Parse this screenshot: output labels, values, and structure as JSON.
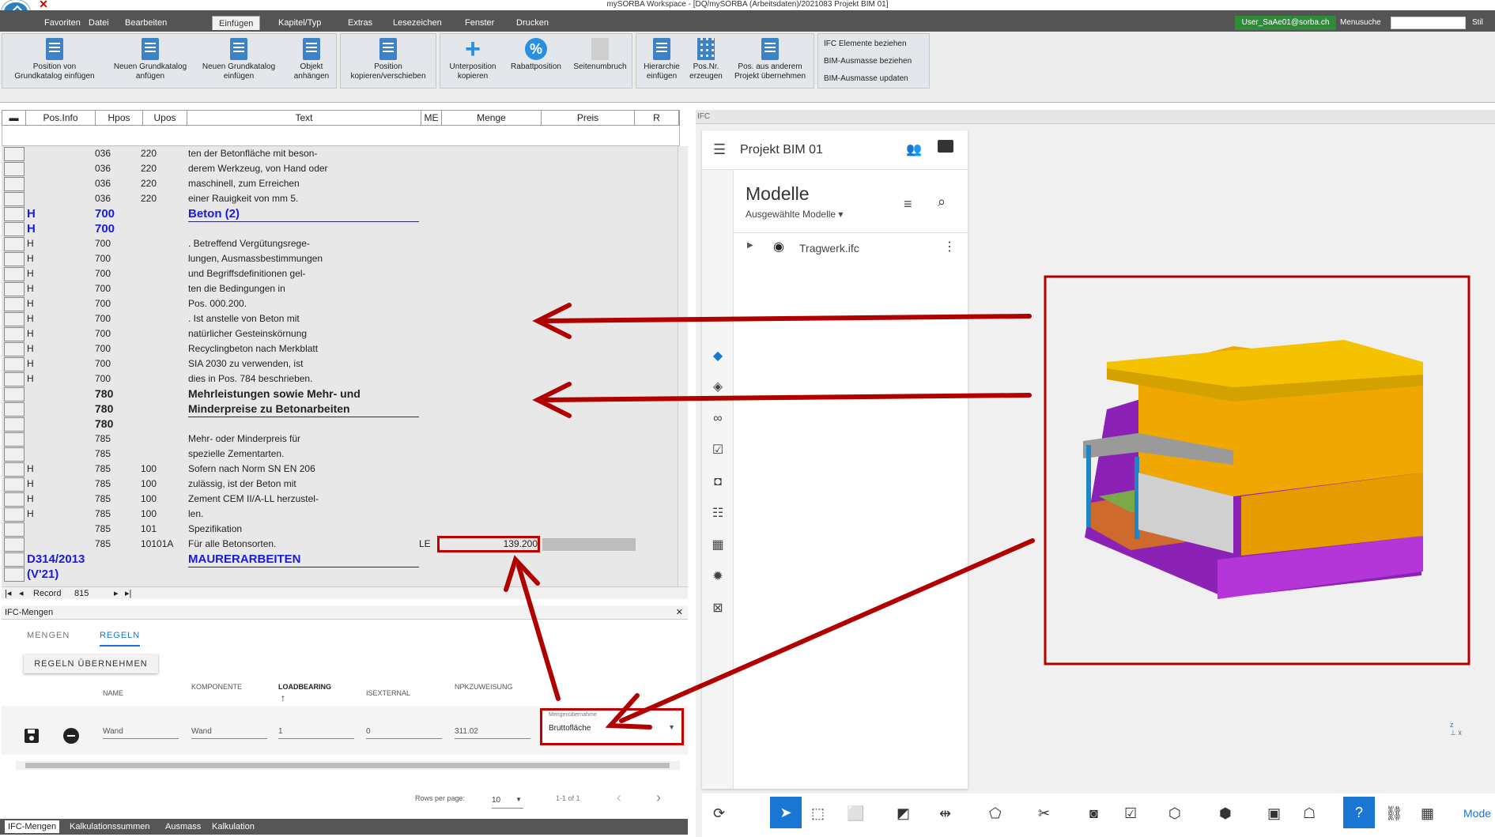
{
  "window": {
    "title": "mySORBA Workspace - [DQ/mySORBA (Arbeitsdaten)/2021083 Projekt BIM 01]"
  },
  "menu": {
    "tabs": [
      "Favoriten",
      "Datei",
      "Bearbeiten",
      "Einfügen",
      "Kapitel/Typ",
      "Extras",
      "Lesezeichen",
      "Fenster",
      "Drucken"
    ],
    "active": "Einfügen",
    "user": "User_SaAe01@sorba.ch",
    "search_label": "Menusuche",
    "style_label": "Stil"
  },
  "ribbon": {
    "buttons": [
      {
        "l1": "Position von",
        "l2": "Grundkatalog einfügen",
        "icon": "doc-icon"
      },
      {
        "l1": "Neuen Grundkatalog",
        "l2": "anfügen",
        "icon": "doc-icon"
      },
      {
        "l1": "Neuen Grundkatalog",
        "l2": "einfügen",
        "icon": "doc-icon"
      },
      {
        "l1": "Objekt",
        "l2": "anhängen",
        "icon": "doc-icon"
      },
      {
        "l1": "Position",
        "l2": "kopieren/verschieben",
        "icon": "doc-icon"
      },
      {
        "l1": "Unterposition",
        "l2": "kopieren",
        "icon": "plus-icon"
      },
      {
        "l1": "Rabattposition",
        "l2": "",
        "icon": "percent-icon"
      },
      {
        "l1": "Seitenumbruch",
        "l2": "",
        "icon": "page-break-icon"
      },
      {
        "l1": "Hierarchie",
        "l2": "einfügen",
        "icon": "hierarchy-icon"
      },
      {
        "l1": "Pos.Nr.",
        "l2": "erzeugen",
        "icon": "grid-icon"
      },
      {
        "l1": "Pos. aus anderem",
        "l2": "Projekt übernehmen",
        "icon": "doc-icon"
      }
    ],
    "ifc_buttons": [
      "IFC Elemente beziehen",
      "BIM-Ausmasse beziehen",
      "BIM-Ausmasse updaten"
    ]
  },
  "grid": {
    "columns": [
      "Pos.Info",
      "Hpos",
      "Upos",
      "Text",
      "ME",
      "Menge",
      "Preis",
      "R"
    ],
    "rows": [
      {
        "info": "",
        "hpos": "036",
        "upos": "220",
        "text": "ten der Betonfläche mit beson-",
        "me": "",
        "menge": "",
        "style": ""
      },
      {
        "info": "",
        "hpos": "036",
        "upos": "220",
        "text": "derem Werkzeug, von Hand oder",
        "me": "",
        "menge": "",
        "style": ""
      },
      {
        "info": "",
        "hpos": "036",
        "upos": "220",
        "text": "maschinell, zum Erreichen",
        "me": "",
        "menge": "",
        "style": ""
      },
      {
        "info": "",
        "hpos": "036",
        "upos": "220",
        "text": "einer Rauigkeit von mm 5.",
        "me": "",
        "menge": "",
        "style": ""
      },
      {
        "info": "H",
        "hpos": "700",
        "upos": "",
        "text": "Beton (2)",
        "me": "",
        "menge": "",
        "style": "blue"
      },
      {
        "info": "H",
        "hpos": "700",
        "upos": "",
        "text": "",
        "me": "",
        "menge": "",
        "style": "blue"
      },
      {
        "info": "H",
        "hpos": "700",
        "upos": "",
        "text": ". Betreffend Vergütungsrege-",
        "me": "",
        "menge": "",
        "style": ""
      },
      {
        "info": "H",
        "hpos": "700",
        "upos": "",
        "text": "lungen, Ausmassbestimmungen",
        "me": "",
        "menge": "",
        "style": ""
      },
      {
        "info": "H",
        "hpos": "700",
        "upos": "",
        "text": "und Begriffsdefinitionen gel-",
        "me": "",
        "menge": "",
        "style": ""
      },
      {
        "info": "H",
        "hpos": "700",
        "upos": "",
        "text": "ten die Bedingungen in",
        "me": "",
        "menge": "",
        "style": ""
      },
      {
        "info": "H",
        "hpos": "700",
        "upos": "",
        "text": "Pos. 000.200.",
        "me": "",
        "menge": "",
        "style": ""
      },
      {
        "info": "H",
        "hpos": "700",
        "upos": "",
        "text": ". Ist anstelle von Beton mit",
        "me": "",
        "menge": "",
        "style": ""
      },
      {
        "info": "H",
        "hpos": "700",
        "upos": "",
        "text": "natürlicher Gesteinskörnung",
        "me": "",
        "menge": "",
        "style": ""
      },
      {
        "info": "H",
        "hpos": "700",
        "upos": "",
        "text": "Recyclingbeton nach Merkblatt",
        "me": "",
        "menge": "",
        "style": ""
      },
      {
        "info": "H",
        "hpos": "700",
        "upos": "",
        "text": "SIA 2030 zu verwenden, ist",
        "me": "",
        "menge": "",
        "style": ""
      },
      {
        "info": "H",
        "hpos": "700",
        "upos": "",
        "text": "dies in Pos. 784 beschrieben.",
        "me": "",
        "menge": "",
        "style": ""
      },
      {
        "info": "",
        "hpos": "780",
        "upos": "",
        "text": "Mehrleistungen sowie Mehr- und",
        "me": "",
        "menge": "",
        "style": "bold"
      },
      {
        "info": "",
        "hpos": "780",
        "upos": "",
        "text": "Minderpreise zu Betonarbeiten",
        "me": "",
        "menge": "",
        "style": "bold-ul"
      },
      {
        "info": "",
        "hpos": "780",
        "upos": "",
        "text": "",
        "me": "",
        "menge": "",
        "style": "bold"
      },
      {
        "info": "",
        "hpos": "785",
        "upos": "",
        "text": "Mehr- oder Minderpreis für",
        "me": "",
        "menge": "",
        "style": ""
      },
      {
        "info": "",
        "hpos": "785",
        "upos": "",
        "text": "spezielle Zementarten.",
        "me": "",
        "menge": "",
        "style": ""
      },
      {
        "info": "H",
        "hpos": "785",
        "upos": "100",
        "text": "Sofern nach Norm SN EN 206",
        "me": "",
        "menge": "",
        "style": ""
      },
      {
        "info": "H",
        "hpos": "785",
        "upos": "100",
        "text": "zulässig, ist der Beton mit",
        "me": "",
        "menge": "",
        "style": ""
      },
      {
        "info": "H",
        "hpos": "785",
        "upos": "100",
        "text": "Zement CEM II/A-LL herzustel-",
        "me": "",
        "menge": "",
        "style": ""
      },
      {
        "info": "H",
        "hpos": "785",
        "upos": "100",
        "text": "len.",
        "me": "",
        "menge": "",
        "style": ""
      },
      {
        "info": "",
        "hpos": "785",
        "upos": "101",
        "text": "Spezifikation",
        "me": "",
        "menge": "",
        "style": ""
      },
      {
        "info": "",
        "hpos": "785",
        "upos": "10101A",
        "text": "Für alle Betonsorten.",
        "me": "LE",
        "menge": "139.200",
        "style": ""
      },
      {
        "info": "D314/2013",
        "hpos": "",
        "upos": "",
        "text": "MAURERARBEITEN",
        "me": "",
        "menge": "",
        "style": "blue"
      },
      {
        "info": "(V'21)",
        "hpos": "",
        "upos": "",
        "text": "",
        "me": "",
        "menge": "",
        "style": "blue"
      }
    ],
    "record_label": "Record",
    "record_value": "815"
  },
  "ifc_mengen": {
    "title": "IFC-Mengen",
    "tabs": [
      "MENGEN",
      "REGELN"
    ],
    "active_tab": "REGELN",
    "apply_button": "REGELN ÜBERNEHMEN",
    "columns": [
      "NAME",
      "KOMPONENTE",
      "LOADBEARING",
      "ISEXTERNAL",
      "NPKZUWEISUNG"
    ],
    "row": {
      "name": "Wand",
      "komponente": "Wand",
      "loadbearing": "1",
      "isexternal": "0",
      "npk": "311.02"
    },
    "mengen_label": "Mengenübernahme",
    "mengen_value": "Bruttofläche",
    "rows_per_page_label": "Rows per page:",
    "rows_per_page": "10",
    "page_info": "1-1 of 1"
  },
  "bottom_tabs": [
    "IFC-Mengen",
    "Kalkulationssummen",
    "Ausmass",
    "Kalkulation"
  ],
  "ifc": {
    "pane_title": "IFC",
    "project": "Projekt BIM 01",
    "models_title": "Modelle",
    "models_filter": "Ausgewählte Modelle",
    "model_file": "Tragwerk.ifc",
    "toolbar_right_label": "Mode"
  },
  "colors": {
    "accent": "#1976d2",
    "annotation": "#b00000",
    "ribbon": "#545454",
    "grid_blue": "#1a1adf"
  }
}
